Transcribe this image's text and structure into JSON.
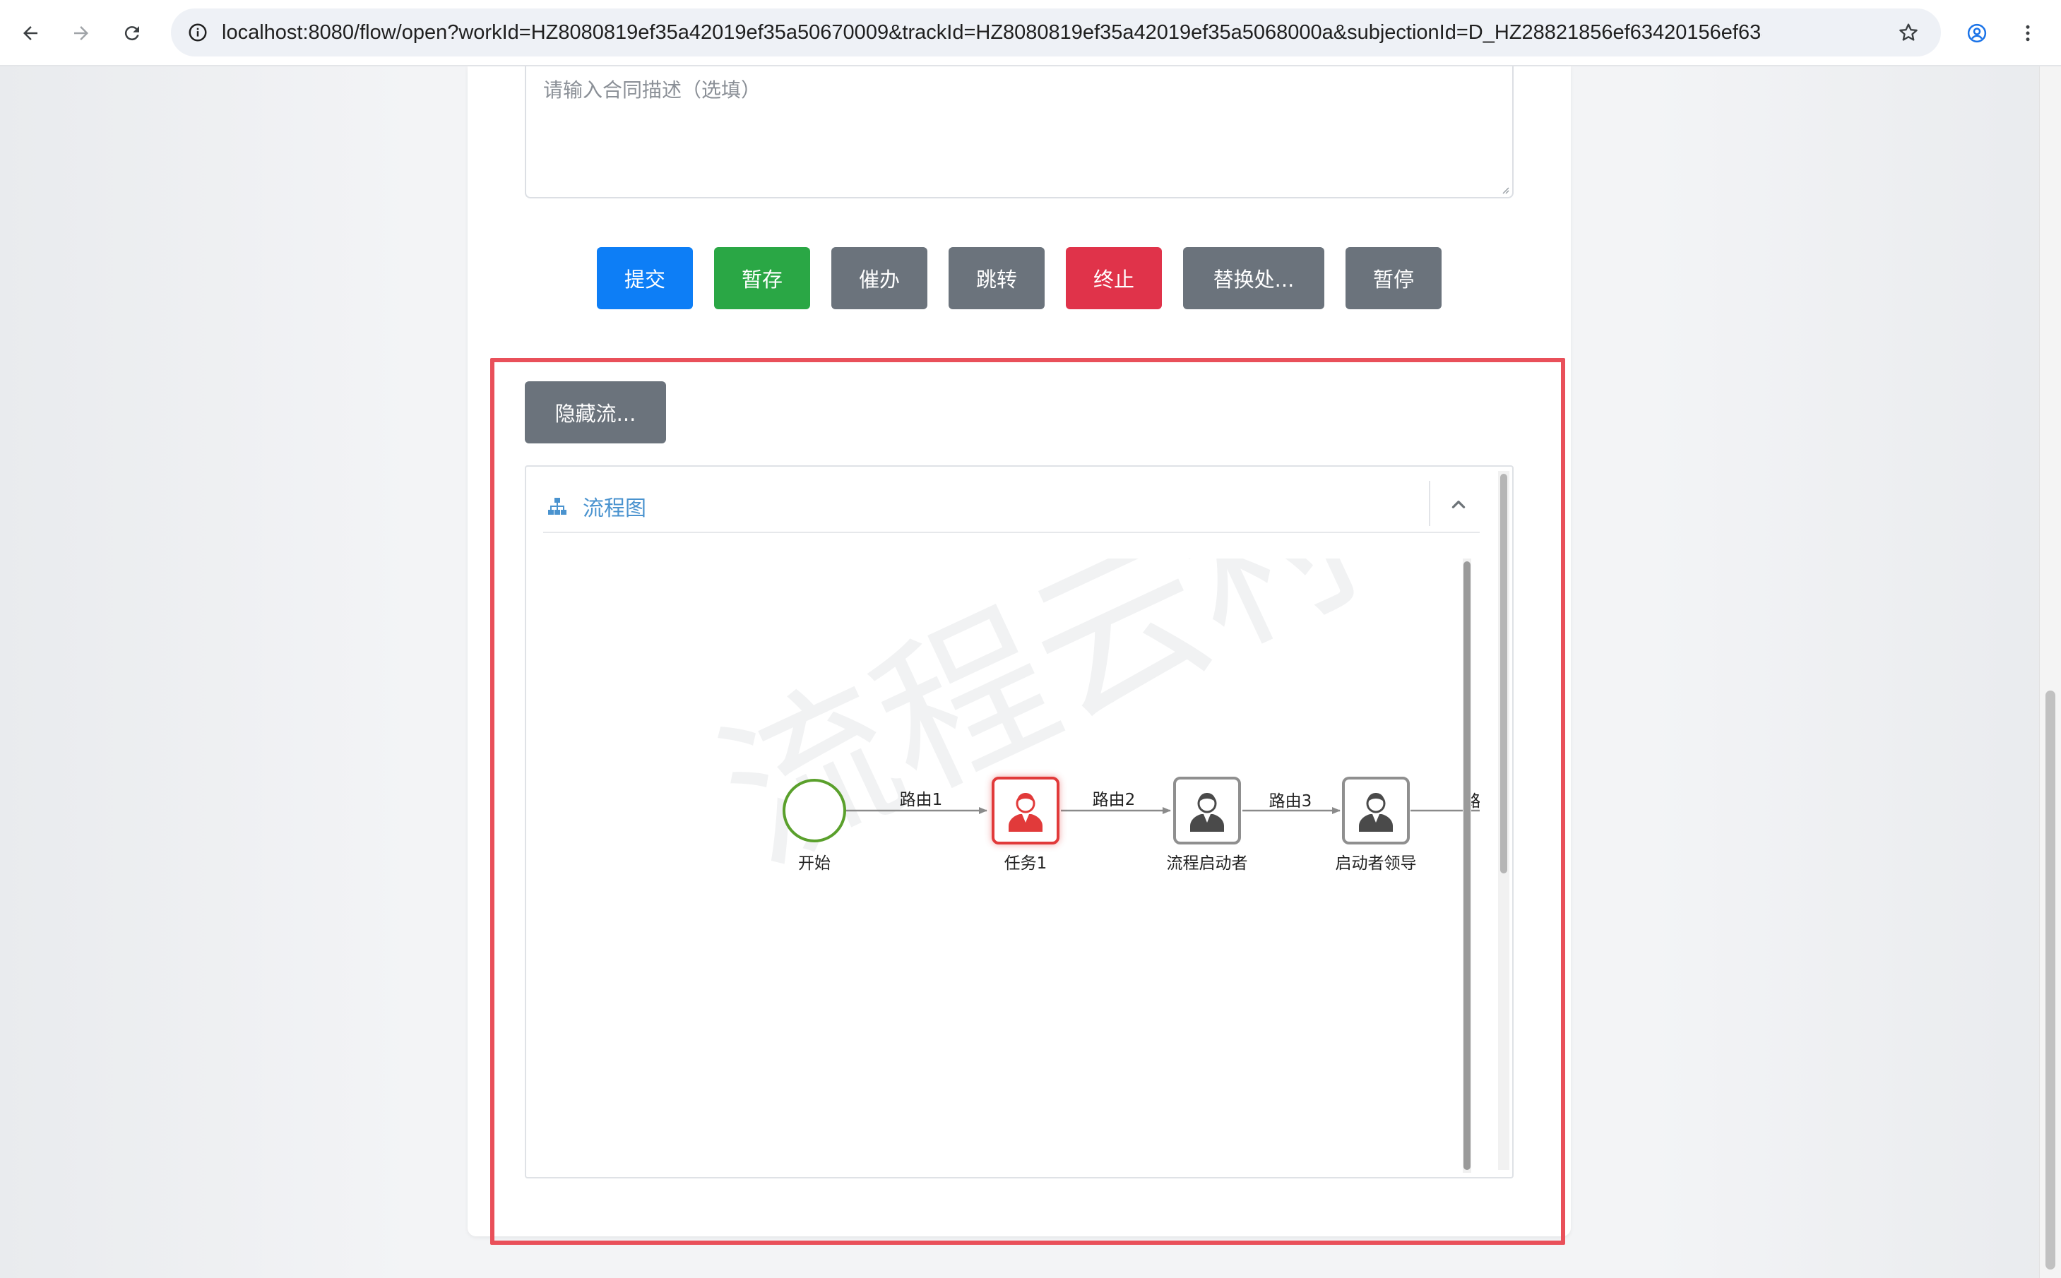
{
  "browser": {
    "url": "localhost:8080/flow/open?workId=HZ8080819ef35a42019ef35a50670009&trackId=HZ8080819ef35a42019ef35a5068000a&subjectionId=D_HZ28821856ef63420156ef634..."
  },
  "form": {
    "description_placeholder": "请输入合同描述（选填）"
  },
  "actions": {
    "submit": "提交",
    "save_draft": "暂存",
    "urge": "催办",
    "jump": "跳转",
    "terminate": "终止",
    "replace_handler": "替换处...",
    "pause": "暂停"
  },
  "flow_section": {
    "hide_button": "隐藏流...",
    "panel_title": "流程图",
    "watermark": "流程云村",
    "nodes": {
      "start": "开始",
      "task1": "任务1",
      "initiator": "流程启动者",
      "initiator_leader": "启动者领导"
    },
    "edges": {
      "route1": "路由1",
      "route2": "路由2",
      "route3": "路由3",
      "route4_partial": "路"
    }
  },
  "colors": {
    "submit": "#0d7ef6",
    "save_draft": "#2aa745",
    "terminate": "#e0334a",
    "neutral": "#6b737c",
    "highlight_border": "#e9505a",
    "active_task": "#e13a3a",
    "start_event": "#5aa02c"
  },
  "icons": {
    "back": "arrow-left-icon",
    "forward": "arrow-right-icon",
    "reload": "reload-icon",
    "site_info": "info-icon",
    "bookmark": "star-icon",
    "profile": "account-icon",
    "menu": "more-vert-icon",
    "panel": "sitemap-icon",
    "collapse": "chevron-up-icon"
  }
}
